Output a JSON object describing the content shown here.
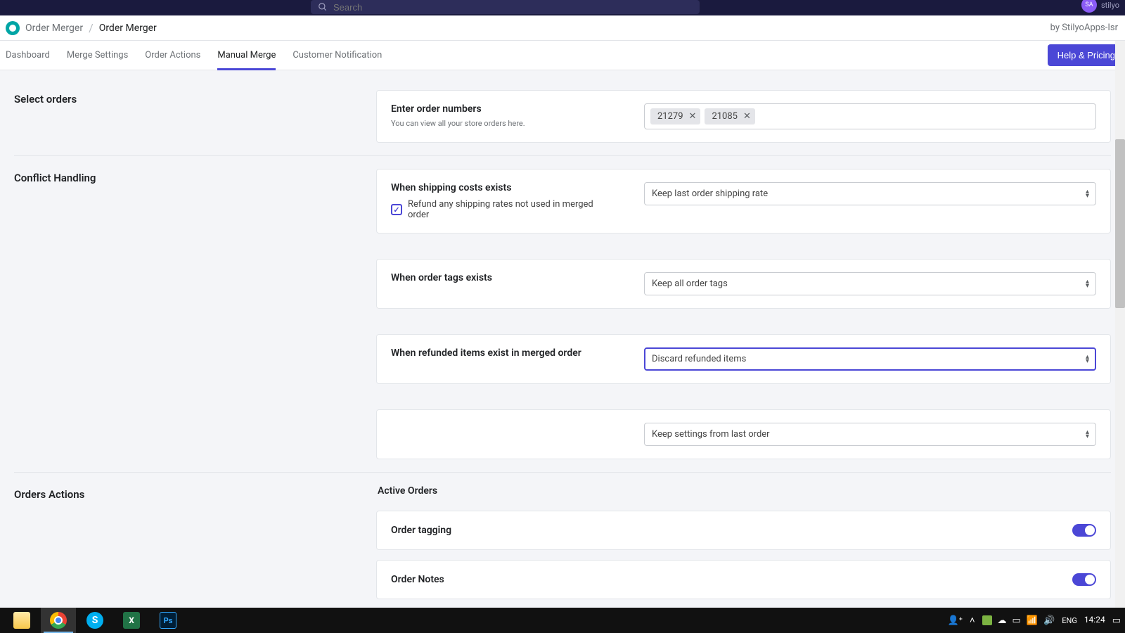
{
  "top": {
    "search_placeholder": "Search",
    "avatar_initials": "SA",
    "avatar_name": "stilyo"
  },
  "breadcrumb": {
    "app": "Order Merger",
    "page": "Order Merger",
    "vendor": "by StilyoApps-Isr"
  },
  "tabs": {
    "items": [
      "Dashboard",
      "Merge Settings",
      "Order Actions",
      "Manual Merge",
      "Customer Notification"
    ],
    "active_index": 3,
    "help_button": "Help & Pricing"
  },
  "sections": {
    "select_orders": {
      "label": "Select orders",
      "card_title": "Enter order numbers",
      "card_hint": "You can view all your store orders here.",
      "tags": [
        "21279",
        "21085"
      ]
    },
    "conflict": {
      "label": "Conflict Handling",
      "shipping": {
        "title": "When shipping costs exists",
        "select_value": "Keep last order shipping rate",
        "refund_checkbox_label": "Refund any shipping rates not used in merged order",
        "refund_checked": true
      },
      "tags": {
        "title": "When order tags exists",
        "select_value": "Keep all order tags"
      },
      "refunded": {
        "title": "When refunded items exist in merged order",
        "select_value": "Discard refunded items"
      },
      "last": {
        "title": "",
        "select_value": "Keep settings from last order"
      }
    },
    "orders_actions": {
      "label": "Orders Actions",
      "active_title": "Active Orders",
      "toggles": [
        {
          "label": "Order tagging",
          "on": true
        },
        {
          "label": "Order Notes",
          "on": true
        }
      ]
    }
  },
  "taskbar": {
    "lang": "ENG",
    "time": "14:24"
  }
}
